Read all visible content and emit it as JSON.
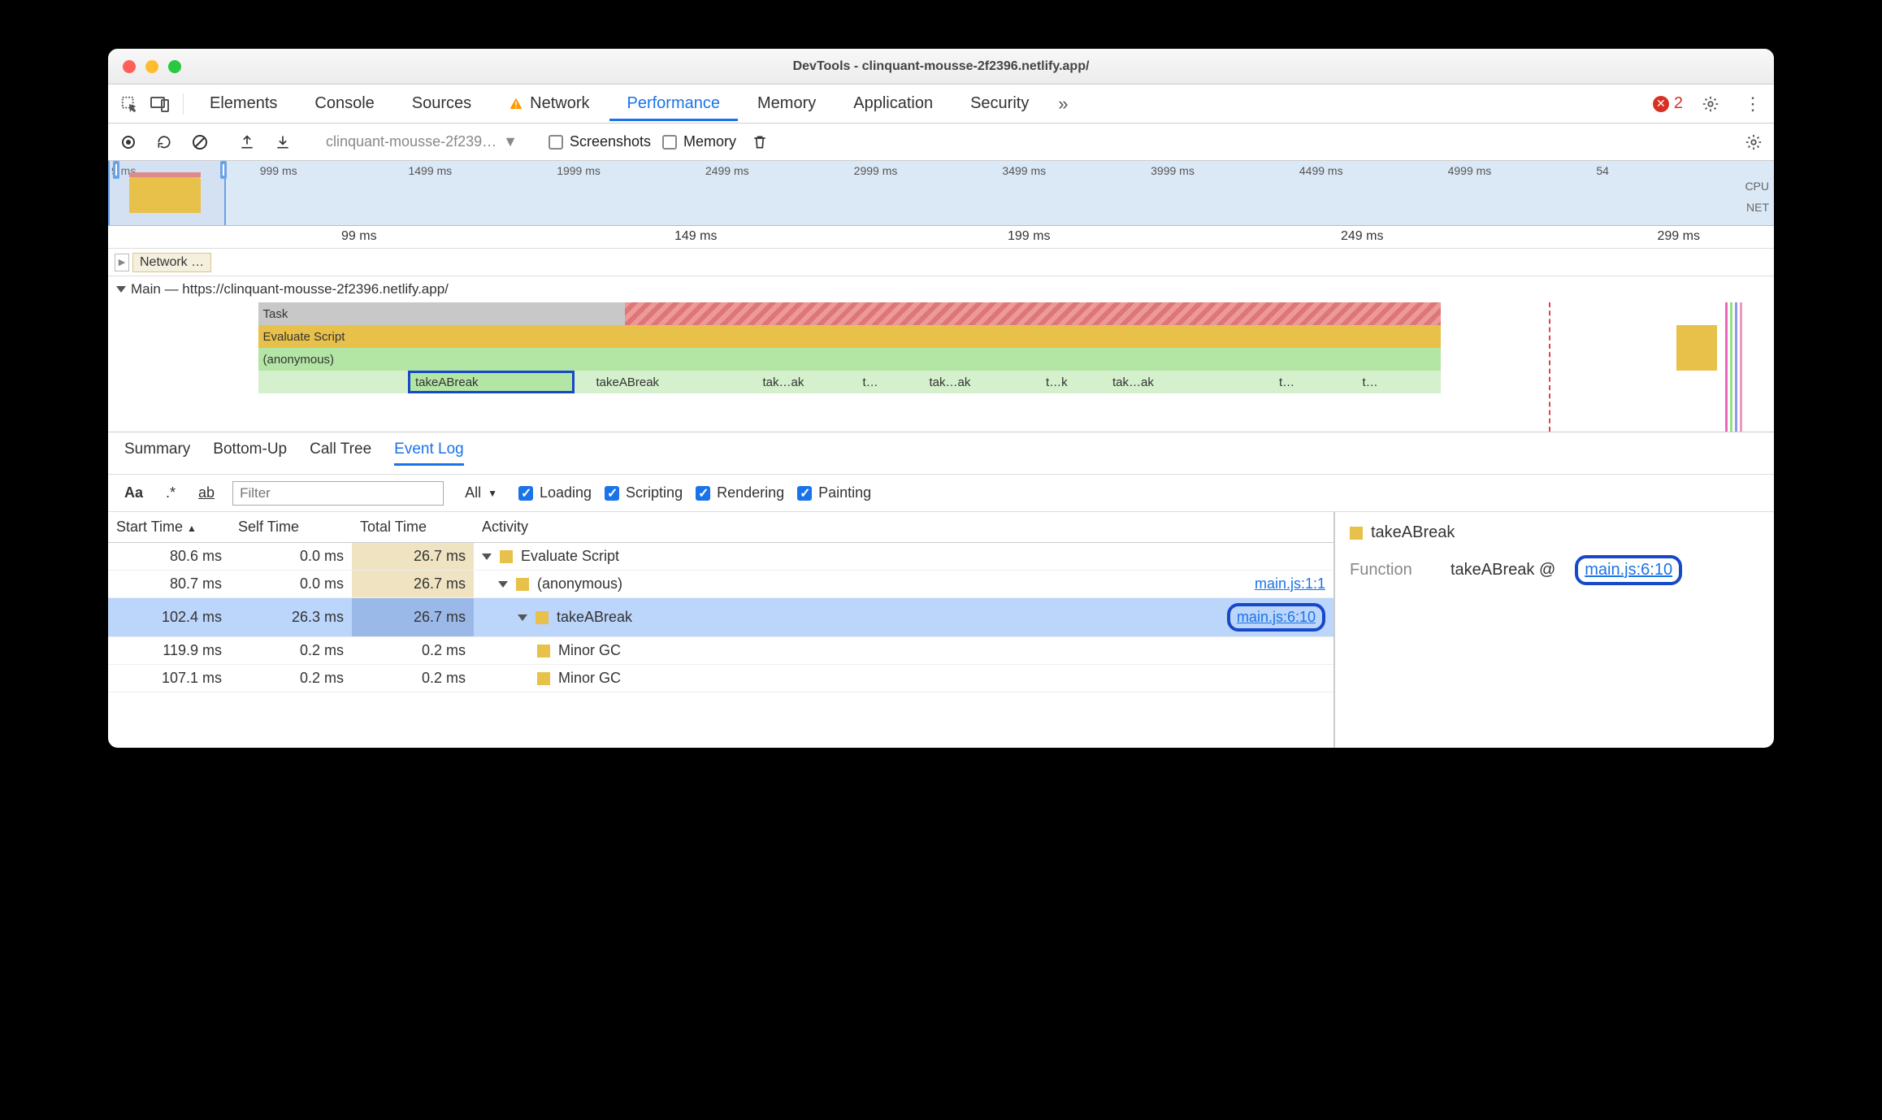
{
  "window_title": "DevTools - clinquant-mousse-2f2396.netlify.app/",
  "tabs": {
    "elements": "Elements",
    "console": "Console",
    "sources": "Sources",
    "network": "Network",
    "performance": "Performance",
    "memory": "Memory",
    "application": "Application",
    "security": "Security"
  },
  "error_count": "2",
  "toolbar": {
    "profile_select": "clinquant-mousse-2f239…",
    "screenshots": "Screenshots",
    "memory": "Memory"
  },
  "overview_ticks": [
    "9 ms",
    "999 ms",
    "1499 ms",
    "1999 ms",
    "2499 ms",
    "2999 ms",
    "3499 ms",
    "3999 ms",
    "4499 ms",
    "4999 ms",
    "54"
  ],
  "overview_labels": {
    "cpu": "CPU",
    "net": "NET"
  },
  "detail_ticks": [
    {
      "pos": "14%",
      "label": "99 ms"
    },
    {
      "pos": "34%",
      "label": "149 ms"
    },
    {
      "pos": "54%",
      "label": "199 ms"
    },
    {
      "pos": "74%",
      "label": "249 ms"
    },
    {
      "pos": "93%",
      "label": "299 ms"
    }
  ],
  "network_label": "Network …",
  "main_label": "Main — https://clinquant-mousse-2f2396.netlify.app/",
  "flame": {
    "task": "Task",
    "eval": "Evaluate Script",
    "anon": "(anonymous)",
    "calls": [
      "takeABreak",
      "takeABreak",
      "tak…ak",
      "t…",
      "tak…ak",
      "t…k",
      "tak…ak",
      "t…",
      "t…"
    ]
  },
  "bottom_tabs": {
    "summary": "Summary",
    "bottomup": "Bottom-Up",
    "calltree": "Call Tree",
    "eventlog": "Event Log"
  },
  "filter": {
    "placeholder": "Filter",
    "all": "All",
    "loading": "Loading",
    "scripting": "Scripting",
    "rendering": "Rendering",
    "painting": "Painting"
  },
  "table": {
    "headers": {
      "start": "Start Time",
      "self": "Self Time",
      "total": "Total Time",
      "activity": "Activity"
    },
    "rows": [
      {
        "start": "80.6 ms",
        "self": "0.0 ms",
        "total": "26.7 ms",
        "activity": "Evaluate Script",
        "link": "",
        "indent": 0,
        "caret": true,
        "sq": "yellow",
        "hl": true
      },
      {
        "start": "80.7 ms",
        "self": "0.0 ms",
        "total": "26.7 ms",
        "activity": "(anonymous)",
        "link": "main.js:1:1",
        "indent": 1,
        "caret": true,
        "sq": "yellow",
        "hl": true
      },
      {
        "start": "102.4 ms",
        "self": "26.3 ms",
        "total": "26.7 ms",
        "activity": "takeABreak",
        "link": "main.js:6:10",
        "indent": 2,
        "caret": true,
        "sq": "yellow",
        "sel": true,
        "ring": true
      },
      {
        "start": "119.9 ms",
        "self": "0.2 ms",
        "total": "0.2 ms",
        "activity": "Minor GC",
        "link": "",
        "indent": 3,
        "caret": false,
        "sq": "yellow"
      },
      {
        "start": "107.1 ms",
        "self": "0.2 ms",
        "total": "0.2 ms",
        "activity": "Minor GC",
        "link": "",
        "indent": 3,
        "caret": false,
        "sq": "yellow"
      }
    ]
  },
  "detail_panel": {
    "title": "takeABreak",
    "fn_label": "Function",
    "fn_name": "takeABreak @",
    "fn_link": "main.js:6:10"
  }
}
